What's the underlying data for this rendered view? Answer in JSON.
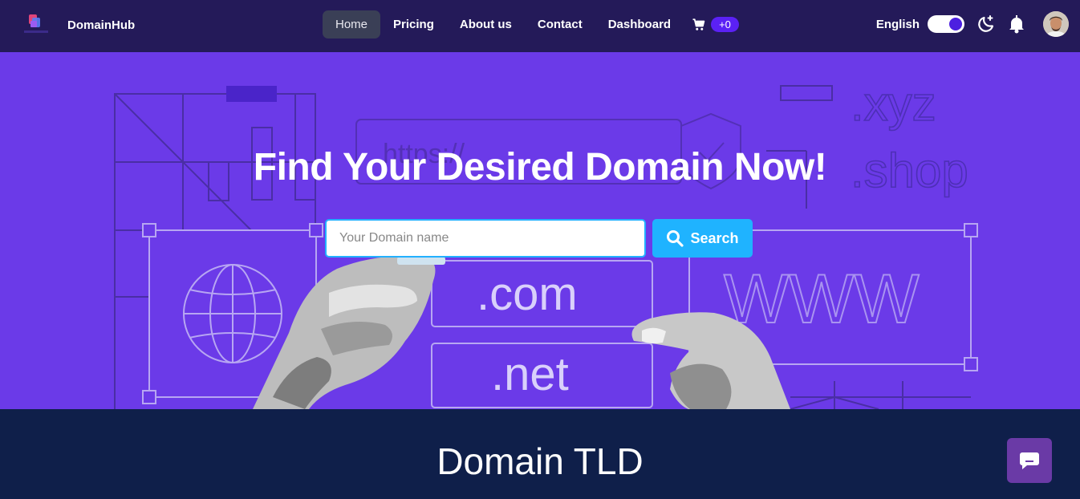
{
  "brand": {
    "name": "DomainHub",
    "logo_icon": "domainhub-logo-icon"
  },
  "nav": {
    "items": [
      {
        "label": "Home",
        "active": true
      },
      {
        "label": "Pricing",
        "active": false
      },
      {
        "label": "About us",
        "active": false
      },
      {
        "label": "Contact",
        "active": false
      },
      {
        "label": "Dashboard",
        "active": false
      }
    ],
    "cart": {
      "icon": "cart-icon",
      "badge": "+0"
    }
  },
  "tools": {
    "language": "English",
    "toggle_on": true,
    "theme_icon": "moon-sparkle-icon",
    "bell_icon": "bell-icon",
    "avatar": "user-avatar"
  },
  "hero": {
    "title": "Find Your Desired Domain Now!",
    "search": {
      "placeholder": "Your Domain name",
      "value": "",
      "button_label": "Search",
      "button_icon": "search-icon"
    },
    "artwork": {
      "https": "https://",
      "xyz": ".xyz",
      "shop": ".shop",
      "com": ".com",
      "net": ".net",
      "www": "WWW"
    }
  },
  "tld": {
    "title": "Domain TLD"
  },
  "chat": {
    "icon": "chat-bubble-icon"
  },
  "colors": {
    "navbar": "#241a59",
    "hero": "#6b3ae8",
    "accent": "#1fb3ff",
    "section": "#0f1f4a",
    "badge": "#5b21f5",
    "chat": "#6a3aa6"
  }
}
